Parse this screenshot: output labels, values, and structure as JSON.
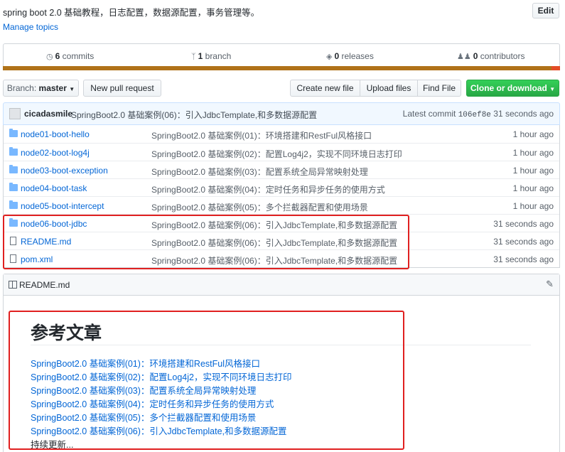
{
  "repo": {
    "description": "spring boot 2.0 基础教程，日志配置，数据源配置，事务管理等。",
    "manage_topics": "Manage topics",
    "edit_label": "Edit"
  },
  "summary": {
    "commits": {
      "count": "6",
      "label": "commits",
      "icon": "history-icon"
    },
    "branches": {
      "count": "1",
      "label": "branch",
      "icon": "branch-icon"
    },
    "releases": {
      "count": "0",
      "label": "releases",
      "icon": "tag-icon"
    },
    "contributors": {
      "count": "0",
      "label": "contributors",
      "icon": "people-icon"
    },
    "language_colors": [
      "#b07219",
      "#e34c26"
    ]
  },
  "toolbar": {
    "branch_prefix": "Branch:",
    "branch_name": "master",
    "new_pr": "New pull request",
    "create_file": "Create new file",
    "upload_files": "Upload files",
    "find_file": "Find File",
    "clone": "Clone or download"
  },
  "commit": {
    "author": "cicadasmile",
    "message": "SpringBoot2.0 基础案例(06)：引入JdbcTemplate,和多数据源配置",
    "latest_label": "Latest commit",
    "sha": "106ef8e",
    "age": "31 seconds ago"
  },
  "files": [
    {
      "type": "dir",
      "name": "node01-boot-hello",
      "message": "SpringBoot2.0 基础案例(01)：环境搭建和RestFul风格接口",
      "age": "1 hour ago"
    },
    {
      "type": "dir",
      "name": "node02-boot-log4j",
      "message": "SpringBoot2.0 基础案例(02)：配置Log4j2，实现不同环境日志打印",
      "age": "1 hour ago"
    },
    {
      "type": "dir",
      "name": "node03-boot-exception",
      "message": "SpringBoot2.0 基础案例(03)：配置系统全局异常映射处理",
      "age": "1 hour ago"
    },
    {
      "type": "dir",
      "name": "node04-boot-task",
      "message": "SpringBoot2.0 基础案例(04)：定时任务和异步任务的使用方式",
      "age": "1 hour ago"
    },
    {
      "type": "dir",
      "name": "node05-boot-intercept",
      "message": "SpringBoot2.0 基础案例(05)：多个拦截器配置和使用场景",
      "age": "1 hour ago"
    },
    {
      "type": "dir",
      "name": "node06-boot-jdbc",
      "message": "SpringBoot2.0 基础案例(06)：引入JdbcTemplate,和多数据源配置",
      "age": "31 seconds ago"
    },
    {
      "type": "file",
      "name": "README.md",
      "message": "SpringBoot2.0 基础案例(06)：引入JdbcTemplate,和多数据源配置",
      "age": "31 seconds ago"
    },
    {
      "type": "file",
      "name": "pom.xml",
      "message": "SpringBoot2.0 基础案例(06)：引入JdbcTemplate,和多数据源配置",
      "age": "31 seconds ago"
    }
  ],
  "readme": {
    "filename": "README.md",
    "heading": "参考文章",
    "links": [
      "SpringBoot2.0 基础案例(01)：环境搭建和RestFul风格接口",
      "SpringBoot2.0 基础案例(02)：配置Log4j2，实现不同环境日志打印",
      "SpringBoot2.0 基础案例(03)：配置系统全局异常映射处理",
      "SpringBoot2.0 基础案例(04)：定时任务和异步任务的使用方式",
      "SpringBoot2.0 基础案例(05)：多个拦截器配置和使用场景",
      "SpringBoot2.0 基础案例(06)：引入JdbcTemplate,和多数据源配置"
    ],
    "more": "持续更新..."
  }
}
